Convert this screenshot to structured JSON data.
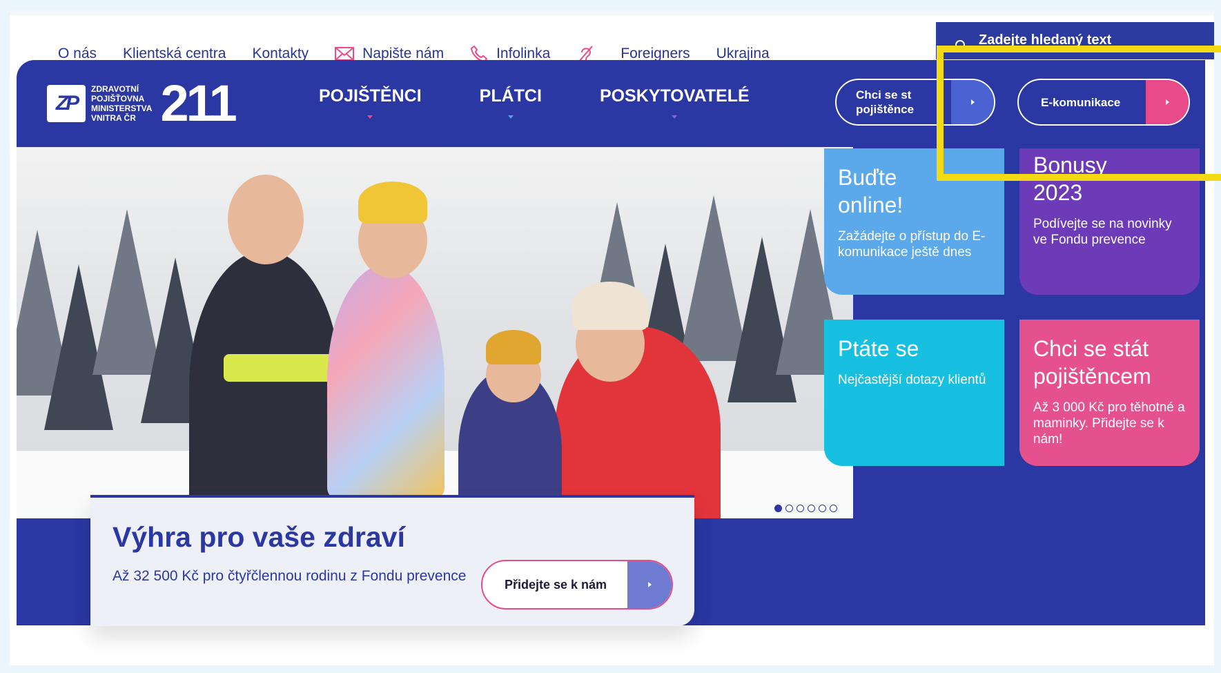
{
  "topbar": {
    "o_nas": "O nás",
    "klientska_centra": "Klientská centra",
    "kontakty": "Kontakty",
    "napiste_nam": "Napište nám",
    "infolinka": "Infolinka",
    "foreigners": "Foreigners",
    "ukrajina": "Ukrajina"
  },
  "search": {
    "placeholder": "Zadejte hledaný text"
  },
  "logo": {
    "mark": "ZP",
    "line1": "ZDRAVOTNÍ",
    "line2": "POJIŠŤOVNA",
    "line3": "MINISTERSTVA",
    "line4": "VNITRA ČR",
    "number": "211"
  },
  "mainnav": {
    "item1": "POJIŠTĚNCI",
    "item2": "PLÁTCI",
    "item3": "POSKYTOVATELÉ"
  },
  "buttons": {
    "chci_line1": "Chci se st",
    "chci_line2": "pojištěnce",
    "ekomunikace": "E-komunikace"
  },
  "promo": {
    "title": "Výhra pro vaše zdraví",
    "subtitle": "Až 32 500 Kč pro čtyřčlennou rodinu z Fondu prevence",
    "button": "Přidejte se k nám"
  },
  "tiles": [
    {
      "title_1": "Buďte",
      "title_2": "online!",
      "text": "Zažádejte o přístup do E-komunikace ještě dnes"
    },
    {
      "title_1": "Bonusy",
      "title_2": "2023",
      "text": "Podívejte se na novinky ve Fondu prevence"
    },
    {
      "title_1": "Ptáte se",
      "title_2": "",
      "text": "Nejčastější dotazy klientů"
    },
    {
      "title_1": "Chci se stát",
      "title_2": "pojištěncem",
      "text": "Až 3 000 Kč pro těhotné a maminky. Přidejte se k nám!"
    }
  ],
  "carousel": {
    "count": 6,
    "active": 1
  },
  "colors": {
    "brand_blue": "#2b37a2",
    "pink": "#e5518f",
    "purple": "#6d3bb8",
    "cyan": "#17bfe0",
    "light_blue": "#5ba8ea",
    "highlight": "#f4da12"
  }
}
